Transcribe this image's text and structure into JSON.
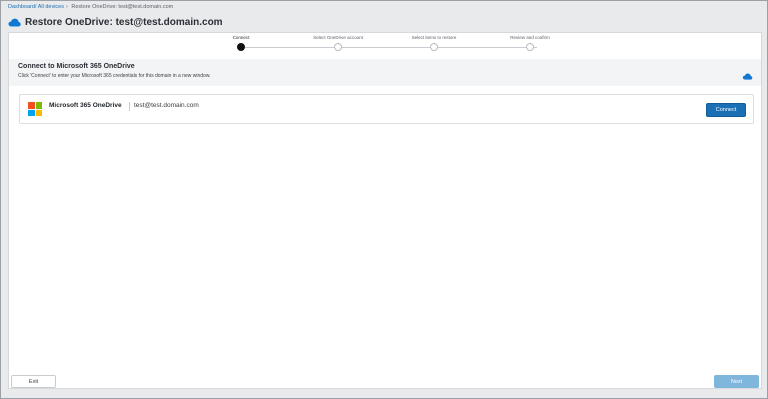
{
  "breadcrumb": {
    "items": [
      "Dashboard",
      "All devices"
    ],
    "current": "Restore OneDrive: test@test.domain.com"
  },
  "header": {
    "icon": "onedrive-cloud-icon",
    "title": "Restore OneDrive: test@test.domain.com"
  },
  "stepper": {
    "steps": [
      {
        "label": "Connect",
        "active": true
      },
      {
        "label": "Select OneDrive account",
        "active": false
      },
      {
        "label": "Select items to restore",
        "active": false
      },
      {
        "label": "Review and confirm",
        "active": false
      }
    ]
  },
  "connect_section": {
    "title": "Connect to Microsoft 365 OneDrive",
    "description": "Click 'Connect' to enter your Microsoft 365 credentials for this domain in a new window.",
    "icon": "onedrive-cloud-icon"
  },
  "account_card": {
    "logo": "microsoft-logo",
    "product": "Microsoft 365 OneDrive",
    "email": "test@test.domain.com",
    "connect_label": "Connect"
  },
  "footer": {
    "exit_label": "Exit",
    "next_label": "Next"
  },
  "colors": {
    "accent": "#1a6fb5",
    "onedrive_blue": "#0f78d4",
    "next_disabled": "#7fb6dc",
    "ms_red": "#f25022",
    "ms_green": "#7fba00",
    "ms_blue": "#00a4ef",
    "ms_yellow": "#ffb900"
  }
}
